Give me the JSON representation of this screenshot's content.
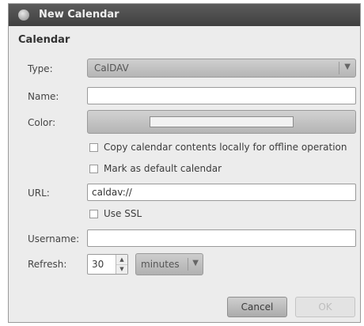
{
  "window": {
    "title": "New Calendar"
  },
  "section": {
    "title": "Calendar"
  },
  "form": {
    "type": {
      "label": "Type:",
      "value": "CalDAV"
    },
    "name": {
      "label": "Name:",
      "value": ""
    },
    "color": {
      "label": "Color:",
      "swatch": "#f2f2f2"
    },
    "copy_offline": {
      "label": "Copy calendar contents locally for offline operation",
      "checked": false
    },
    "default_calendar": {
      "label": "Mark as default calendar",
      "checked": false
    },
    "url": {
      "label": "URL:",
      "value": "caldav://"
    },
    "use_ssl": {
      "label": "Use SSL",
      "checked": false
    },
    "username": {
      "label": "Username:",
      "value": ""
    },
    "refresh": {
      "label": "Refresh:",
      "value": "30",
      "unit": "minutes"
    }
  },
  "buttons": {
    "cancel": "Cancel",
    "ok": "OK"
  }
}
